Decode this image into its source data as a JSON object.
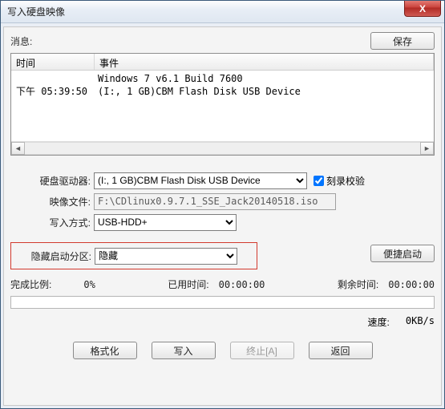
{
  "window": {
    "title": "写入硬盘映像"
  },
  "controls": {
    "close": "X",
    "save": "保存",
    "quick_start": "便捷启动",
    "format": "格式化",
    "write": "写入",
    "abort": "终止[A]",
    "back": "返回"
  },
  "labels": {
    "message": "消息:",
    "time_col": "时间",
    "event_col": "事件",
    "disk_drive": "硬盘驱动器:",
    "image_file": "映像文件:",
    "write_mode": "写入方式:",
    "hide_boot": "隐藏启动分区:",
    "burn_verify": "刻录校验",
    "progress": "完成比例:",
    "elapsed": "已用时间:",
    "remain": "剩余时间:",
    "speed": "速度:"
  },
  "log": [
    {
      "time": "",
      "event": "Windows 7 v6.1 Build 7600"
    },
    {
      "time": "下午 05:39:50",
      "event": "(I:, 1 GB)CBM Flash Disk USB Device"
    }
  ],
  "form": {
    "disk_drive": "(I:, 1 GB)CBM Flash Disk USB Device",
    "image_file": "F:\\CDlinux0.9.7.1_SSE_Jack20140518.iso",
    "write_mode": "USB-HDD+",
    "hide_boot": "隐藏",
    "burn_verify_checked": true
  },
  "status": {
    "progress": "0%",
    "elapsed": "00:00:00",
    "remain": "00:00:00",
    "speed": "0KB/s"
  }
}
